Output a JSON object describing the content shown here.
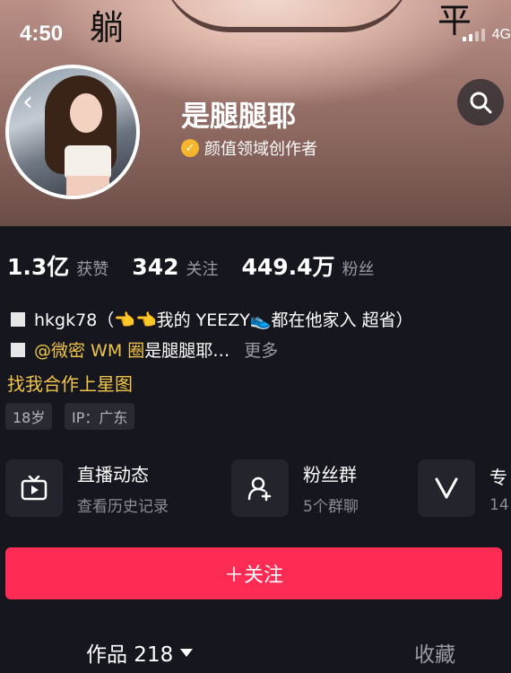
{
  "status": {
    "time": "4:50",
    "carrier": "4G"
  },
  "header": {
    "corner_left_char": "躺",
    "corner_right_char": "平"
  },
  "profile": {
    "name": "是腿腿耶",
    "verified_label": "颜值领域创作者"
  },
  "stats": [
    {
      "value": "1.3亿",
      "label": "获赞"
    },
    {
      "value": "342",
      "label": "关注"
    },
    {
      "value": "449.4万",
      "label": "粉丝"
    }
  ],
  "bio": {
    "line1": "hkgk78（👈👈我的 YEEZY👟都在他家入 超省）",
    "line2_link": "@微密 WM 圈",
    "line2_text": " 是腿腿耶…",
    "more": "更多",
    "cta": "找我合作上星图"
  },
  "tags": [
    "18岁",
    "IP：广东"
  ],
  "features": [
    {
      "icon": "live-tv-icon",
      "title": "直播动态",
      "subtitle": "查看历史记录"
    },
    {
      "icon": "fan-group-icon",
      "title": "粉丝群",
      "subtitle": "5个群聊"
    },
    {
      "icon": "v-icon",
      "title": "专",
      "subtitle": "14"
    }
  ],
  "follow_button": "＋关注",
  "tabs": {
    "works": "作品 218",
    "collect": "收藏"
  },
  "colors": {
    "accent": "#fe2c55",
    "gold": "#f1c54a",
    "background": "#16161e"
  }
}
